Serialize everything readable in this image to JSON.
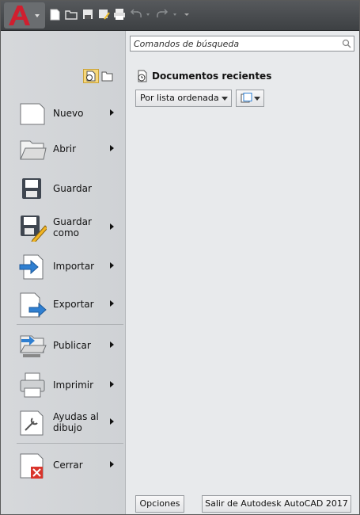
{
  "search": {
    "placeholder": "Comandos de búsqueda"
  },
  "recent": {
    "title": "Documentos recientes",
    "sort_label": "Por lista ordenada"
  },
  "menu": {
    "items": [
      {
        "label": "Nuevo"
      },
      {
        "label": "Abrir"
      },
      {
        "label": "Guardar"
      },
      {
        "label": "Guardar",
        "label2": "como"
      },
      {
        "label": "Importar"
      },
      {
        "label": "Exportar"
      },
      {
        "label": "Publicar"
      },
      {
        "label": "Imprimir"
      },
      {
        "label": "Ayudas al",
        "label2": "dibujo"
      },
      {
        "label": "Cerrar"
      }
    ]
  },
  "footer": {
    "options_label": "Opciones",
    "exit_label": "Salir de Autodesk AutoCAD 2017"
  },
  "colors": {
    "app_red": "#c8102e",
    "titlebar": "#4a4d50",
    "arrow_blue": "#2f7fd1",
    "close_red": "#d9342b"
  }
}
